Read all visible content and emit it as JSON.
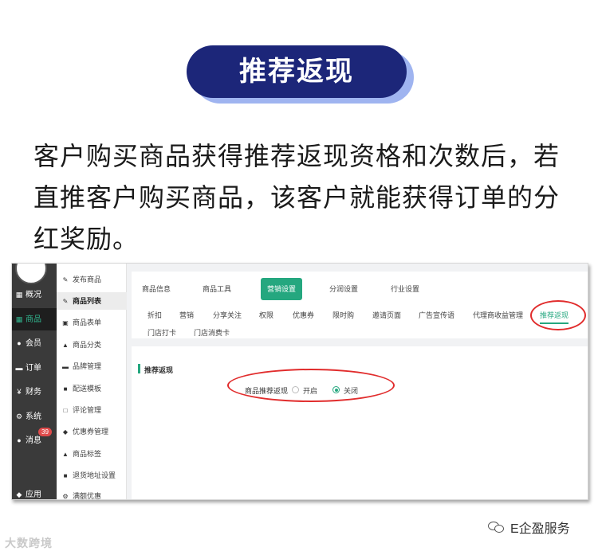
{
  "title": "推荐返现",
  "intro": "客户购买商品获得推荐返现资格和次数后，若直推客户购买商品，该客户就能获得订单的分红奖励。",
  "sidebar_primary": [
    {
      "label": "概况",
      "icon": "home-icon"
    },
    {
      "label": "商品",
      "icon": "grid-icon",
      "active": true
    },
    {
      "label": "会员",
      "icon": "users-icon"
    },
    {
      "label": "订单",
      "icon": "cart-icon"
    },
    {
      "label": "财务",
      "icon": "yen-icon"
    },
    {
      "label": "系统",
      "icon": "gear-icon"
    },
    {
      "label": "消息",
      "icon": "chat-icon",
      "badge": "39"
    },
    {
      "label": "应用",
      "icon": "apps-icon"
    }
  ],
  "sidebar_secondary": [
    {
      "label": "发布商品"
    },
    {
      "label": "商品列表",
      "active": true
    },
    {
      "label": "商品表单"
    },
    {
      "label": "商品分类"
    },
    {
      "label": "品牌管理"
    },
    {
      "label": "配送模板"
    },
    {
      "label": "评论管理"
    },
    {
      "label": "优惠券管理"
    },
    {
      "label": "商品标签"
    },
    {
      "label": "退货地址设置"
    },
    {
      "label": "满额优惠"
    }
  ],
  "top_tabs": [
    {
      "label": "商品信息"
    },
    {
      "label": "商品工具"
    },
    {
      "label": "营销设置",
      "active": true
    },
    {
      "label": "分润设置"
    },
    {
      "label": "行业设置"
    }
  ],
  "sub_tabs": [
    {
      "label": "折扣"
    },
    {
      "label": "营销"
    },
    {
      "label": "分享关注"
    },
    {
      "label": "权限"
    },
    {
      "label": "优惠券"
    },
    {
      "label": "限时购"
    },
    {
      "label": "邀请页面"
    },
    {
      "label": "广告宣传语"
    },
    {
      "label": "代理商收益管理"
    },
    {
      "label": "推荐返现",
      "active": true
    },
    {
      "label": "门店打卡"
    },
    {
      "label": "门店消费卡"
    }
  ],
  "section": {
    "title": "推荐返现",
    "option_label": "商品推荐返现",
    "options": [
      {
        "label": "开启",
        "selected": false
      },
      {
        "label": "关闭",
        "selected": true
      }
    ]
  },
  "footer": {
    "left_watermark": "大数跨境",
    "right_brand": "E企盈服务"
  },
  "colors": {
    "pill_bg": "#1c2679",
    "pill_shadow": "#9fb4f0",
    "accent_green": "#25a77f",
    "highlight_red": "#e12c2c",
    "sidebar_dark": "#3a3a3a"
  }
}
